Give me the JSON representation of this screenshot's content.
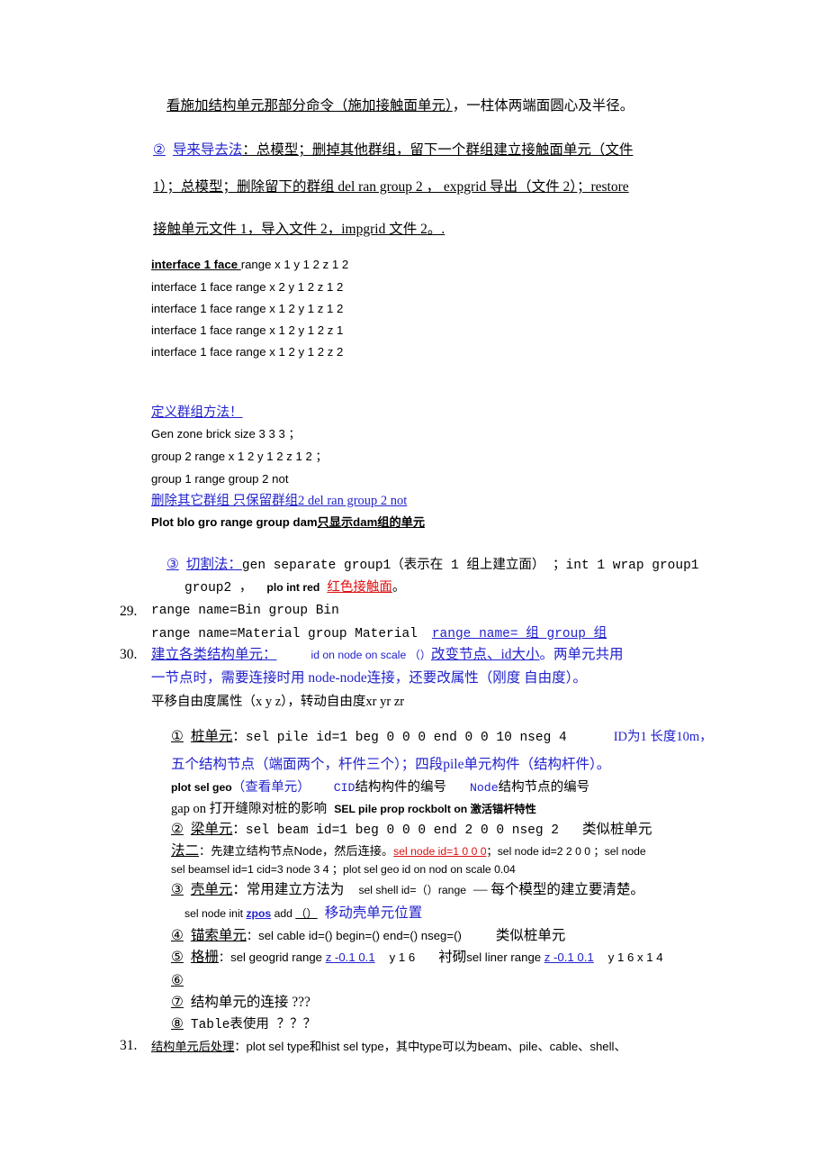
{
  "document": {
    "language": "zh-CN",
    "colors": {
      "text": "#000000",
      "blue": "#2222cc",
      "red": "#dd1111",
      "page": "#ffffff"
    }
  },
  "lines": {
    "l1": "看施加结构单元那部分命令（施加接触面单元）",
    "l1b": "，一柱体两端面圆心及半径。",
    "l2_marker": "②",
    "l2_title": "导来导去法",
    "l2_rest": "：总模型；删掉其他群组，留下一个群组建立接触面单元（文件",
    "l3": "1）；总模型；删除留下的群组 del ran group 2 ，  expgrid 导出（文件 2）；restore",
    "l4": "接触单元文件 1，导入文件 2，impgrid  文件 2。.",
    "iface1_head": "interface 1 face ",
    "iface1_tail": "range x 1 y 1 2 z 1 2",
    "iface2": "interface 1 face range x 2 y 1 2 z 1 2",
    "iface3": "interface 1 face range x 1 2 y 1 z 1 2",
    "iface4": "interface 1 face range x 1 2 y 1 2 z 1",
    "iface5": "interface 1 face range x 1 2 y 1 2 z 2",
    "grp_title": "定义群组方法！",
    "grp1": "Gen zone brick size 3 3 3  ；",
    "grp2": "group 2 range x 1 2 y 1 2 z 1 2  ；",
    "grp3": "group 1 range group 2 not",
    "grp4": "删除其它群组 只保留群组2    del ran group 2 not",
    "grp5a": "Plot blo gro range group dam",
    "grp5b": "只显示dam组的单元",
    "cut_marker": "③",
    "cut_title": "切割法：",
    "cut_rest": "gen separate group1（表示在 1 组上建立面） ；int 1 wrap group1",
    "cut_line2a": "group2 ，",
    "cut_line2b": "plo int red",
    "cut_line2c": "红色接触面",
    "cut_line2d": "。",
    "n29_num": "29.",
    "n29_a": "range name=Bin group Bin",
    "n29_b": "range name=Material group Material",
    "n29_c": "range name= 组 group 组",
    "n30_num": "30.",
    "n30_title": "建立各类结构单元：",
    "n30_a": "id on node on scale （）",
    "n30_b": "改变节点、id大小",
    "n30_c": "。两单元共用",
    "n30_d": "一节点时，需要连接时用 node-node连接，还要改属性（刚度 自由度）。",
    "n30_e": "平移自由度属性（x y z），转动自由度xr yr zr",
    "i1_marker": "①",
    "i1_title": "桩单元",
    "i1_cmd": "：sel pile id=1 beg 0 0 0 end 0 0 10 nseg 4",
    "i1_note": "ID为1 长度10m，",
    "i1_note2": "五个结构节点（端面两个，杆件三个）；四段pile单元构件（结构杆件）。",
    "i1_l3a": "plot sel geo",
    "i1_l3b": "（查看单元）",
    "i1_l3c": "CID",
    "i1_l3d": "结构构件的编号",
    "i1_l3e": "Node",
    "i1_l3f": "结构节点的编号",
    "i1_l4a": "gap on  打开缝隙对桩的影响",
    "i1_l4b": "SEL pile prop rockbolt on  激活锚杆特性",
    "i2_marker": "②",
    "i2_title": "梁单元",
    "i2_cmd": "：sel beam id=1 beg 0 0 0 end 2 0 0 nseg 2",
    "i2_note": "类似桩单元",
    "i2_m2_title": "法二",
    "i2_m2_a": "：先建立结构节点Node，然后连接。",
    "i2_m2_b": "sel node id=1 0 0 0",
    "i2_m2_c": "；sel node id=2 2 0 0 ；sel node",
    "i2_m2_d": "sel beamsel id=1 cid=3 node 3 4  ；plot sel geo id on nod on scale 0.04",
    "i3_marker": "③",
    "i3_title": "壳单元",
    "i3_a": "：常用建立方法为",
    "i3_b": "sel shell id=（）range",
    "i3_c": "— 每个模型的建立要清楚。",
    "i3_l2a": "sel node init ",
    "i3_l2b": "zpos",
    "i3_l2c": " add ",
    "i3_l2d": "（）",
    "i3_l2e": "移动壳单元位置",
    "i4_marker": "④",
    "i4_title": "锚索单元",
    "i4_cmd": "：sel cable id=() begin=() end=() nseg=()",
    "i4_note": "类似桩单元",
    "i5_marker": "⑤",
    "i5_title": "格栅",
    "i5_a": "：sel geogrid range ",
    "i5_b": "z -0.1 0.1",
    "i5_c": "y 1 6",
    "i5_d": "衬砌",
    "i5_e": "sel liner range ",
    "i5_f": "z -0.1 0.1",
    "i5_g": "y 1 6 x 1 4",
    "i6_marker": "⑥",
    "i7_marker": "⑦",
    "i7_text": "结构单元的连接 ???",
    "i8_marker": "⑧",
    "i8_text": "Table表使用 ？？？",
    "n31_num": "31.",
    "n31_title": "结构单元后处理",
    "n31_rest": "：plot sel type和hist sel type，其中type可以为beam、pile、cable、shell、"
  }
}
